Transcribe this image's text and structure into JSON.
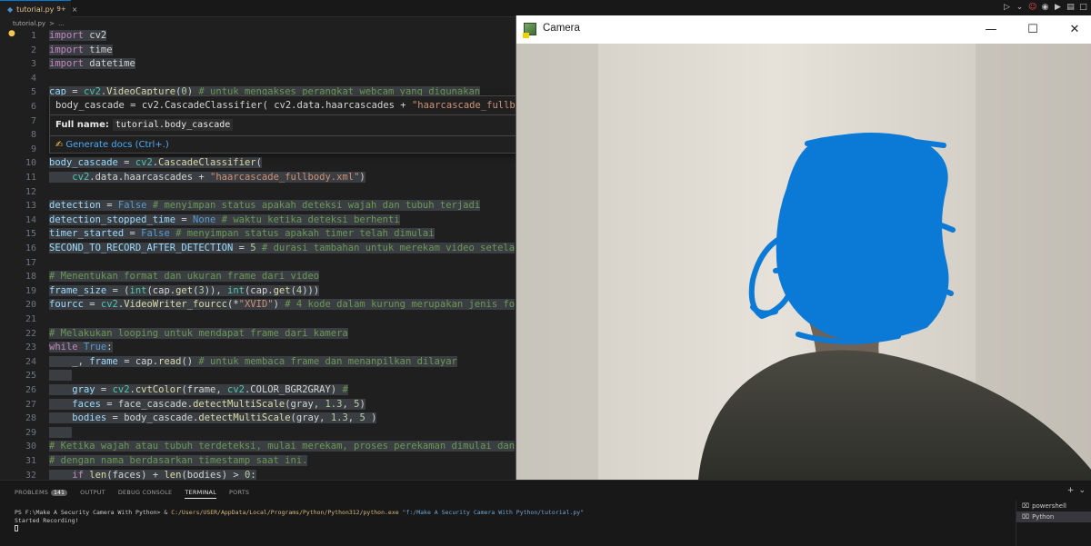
{
  "tab": {
    "filename": "tutorial.py",
    "modified_count": "9+",
    "close": "×"
  },
  "tab_actions": [
    "▷",
    "⌄",
    "☺",
    "◉",
    "▶",
    "▤",
    "□"
  ],
  "breadcrumb": {
    "file": "tutorial.py",
    "sep": ">",
    "more": "..."
  },
  "hover_popup": {
    "signature_pre": "body_cascade = cv2.CascadeClassifier( cv2.data.haarcascades + ",
    "signature_str": "\"haarcascade_fullb",
    "full_name_label": "Full name:",
    "full_name_value": "tutorial.body_cascade",
    "generate_docs": "Generate docs (Ctrl+.)"
  },
  "code_lines": [
    {
      "n": "1"
    },
    {
      "n": "2"
    },
    {
      "n": "3"
    },
    {
      "n": "4"
    },
    {
      "n": "5"
    },
    {
      "n": "6"
    },
    {
      "n": "7"
    },
    {
      "n": "8"
    },
    {
      "n": "9"
    },
    {
      "n": "10"
    },
    {
      "n": "11"
    },
    {
      "n": "12"
    },
    {
      "n": "13"
    },
    {
      "n": "14"
    },
    {
      "n": "15"
    },
    {
      "n": "16"
    },
    {
      "n": "17"
    },
    {
      "n": "18"
    },
    {
      "n": "19"
    },
    {
      "n": "20"
    },
    {
      "n": "21"
    },
    {
      "n": "22"
    },
    {
      "n": "23"
    },
    {
      "n": "24"
    },
    {
      "n": "25"
    },
    {
      "n": "26"
    },
    {
      "n": "27"
    },
    {
      "n": "28"
    },
    {
      "n": "29"
    },
    {
      "n": "30"
    },
    {
      "n": "31"
    },
    {
      "n": "32"
    }
  ],
  "camera_window": {
    "title": "Camera",
    "minimize": "—",
    "maximize": "☐",
    "close": "✕"
  },
  "panel": {
    "tabs": {
      "problems": "PROBLEMS",
      "problems_count": "141",
      "output": "OUTPUT",
      "debug": "DEBUG CONSOLE",
      "terminal": "TERMINAL",
      "ports": "PORTS"
    },
    "actions": [
      "+",
      "⌄"
    ],
    "terminal": {
      "prompt": "PS F:\\Make A Security Camera With Python> & ",
      "exe": "C:/Users/USER/AppData/Local/Programs/Python/Python312/python.exe",
      "script": " \"f:/Make A Security Camera With Python/tutorial.py\"",
      "output": "Started Recording!"
    },
    "terminal_list": [
      {
        "icon": "terminal-icon",
        "label": "powershell"
      },
      {
        "icon": "terminal-icon",
        "label": "Python"
      }
    ]
  },
  "colors": {
    "accent": "#0078d4",
    "drawing": "#0a7ad6",
    "editor_bg": "#1f1f1f"
  }
}
